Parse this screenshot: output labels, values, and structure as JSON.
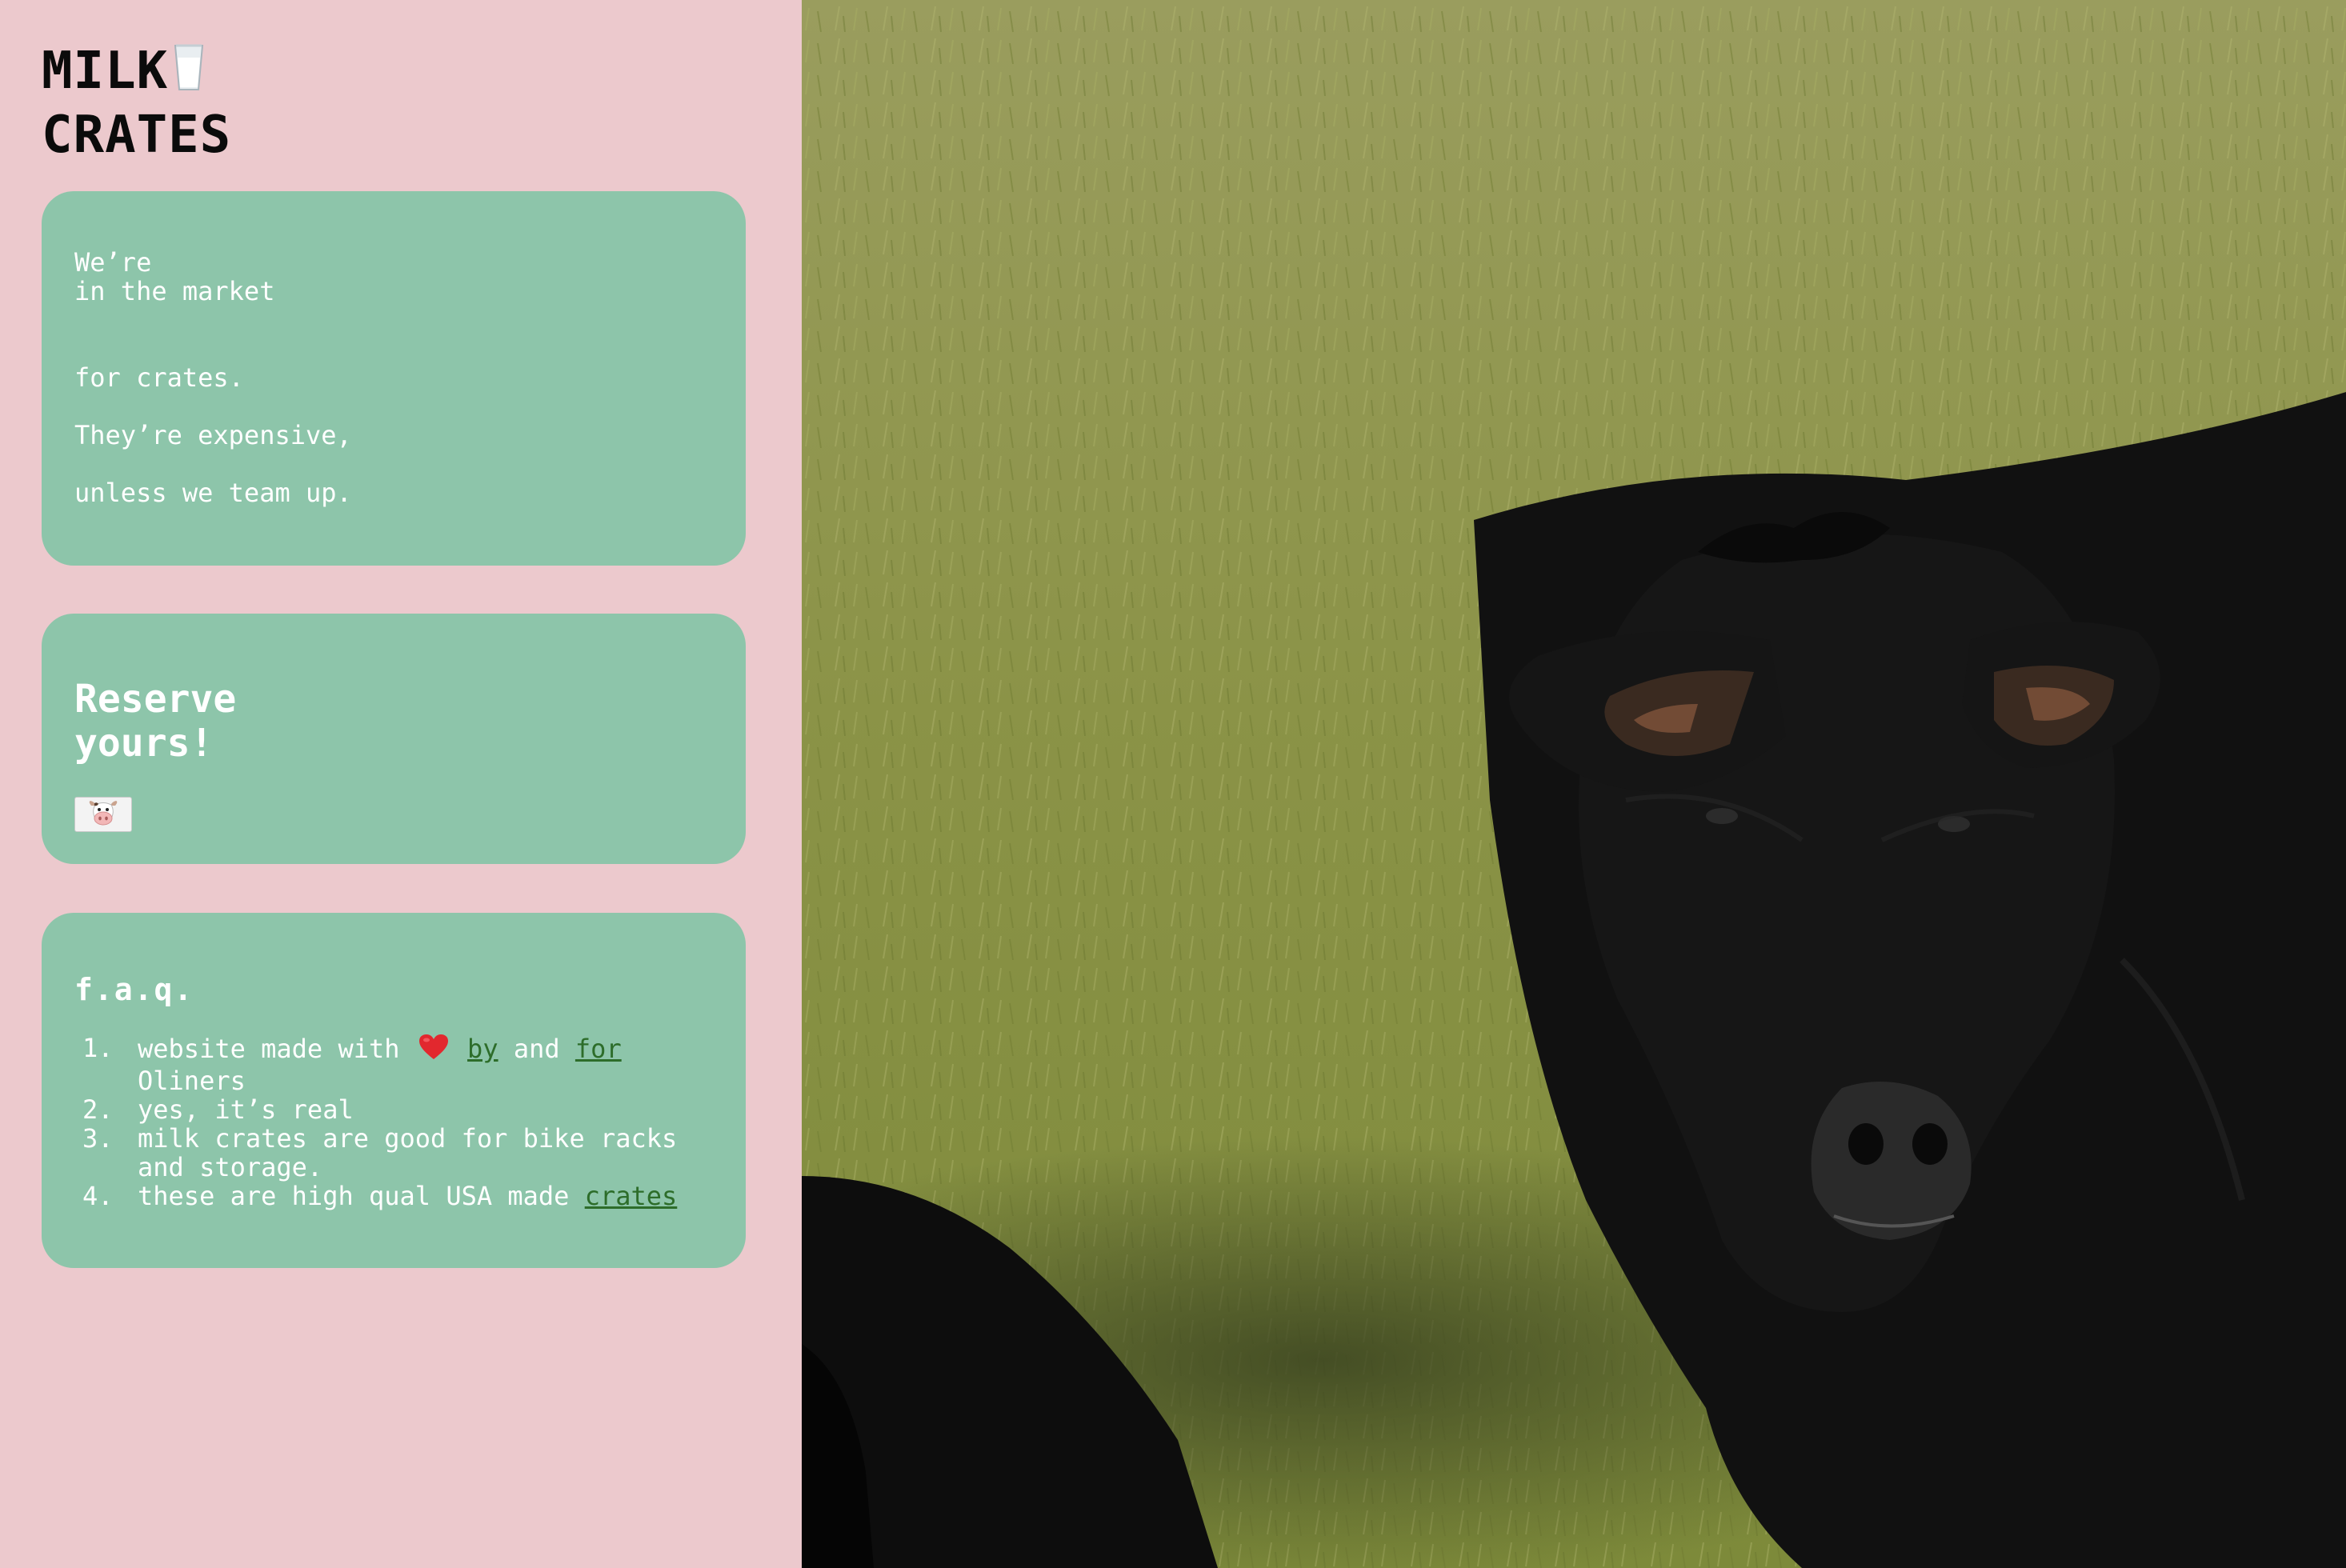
{
  "logo": {
    "line1": "MILK",
    "line2": "CRATES",
    "icon": "milk-glass-icon"
  },
  "intro_card": {
    "line1": "We’re",
    "line2": "in the market",
    "line3": "for crates.",
    "line4": "They’re expensive,",
    "line5": "unless we team up."
  },
  "reserve_card": {
    "title_line1": "Reserve",
    "title_line2": "yours!",
    "button_icon": "cow-face-icon"
  },
  "faq": {
    "title": "f.a.q.",
    "items": [
      {
        "num": "1.",
        "pre": "website made with",
        "icon": "heart-icon",
        "link1": "by",
        "mid": "and",
        "link2": "for",
        "line2": "Oliners"
      },
      {
        "num": "2.",
        "text": "yes, it’s real"
      },
      {
        "num": "3.",
        "line1": "milk crates are good for bike racks",
        "line2": "and storage."
      },
      {
        "num": "4.",
        "pre": "these are high qual USA made",
        "link": "crates"
      }
    ]
  },
  "photo": {
    "subject": "black-cow-photo"
  },
  "colors": {
    "background": "#ecc9cd",
    "card": "#8dc5aa",
    "card_text": "#ffffff",
    "link": "#2d6d2a"
  }
}
